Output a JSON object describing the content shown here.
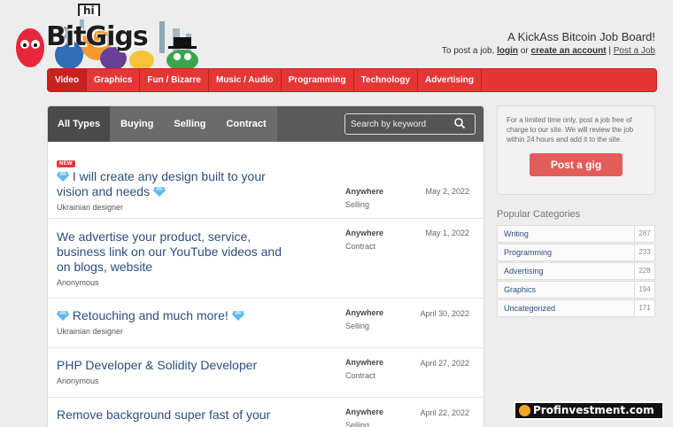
{
  "logo": {
    "hi": "hi",
    "word": "BitGigs"
  },
  "header": {
    "tagline": "A KickAss Bitcoin Job Board!",
    "post_prefix": "To post a job,",
    "login": "login",
    "or": "or",
    "create_account": "create an account",
    "sep": "|",
    "post_job": "Post a Job"
  },
  "nav": [
    "Video",
    "Graphics",
    "Fun / Bizarre",
    "Music / Audio",
    "Programming",
    "Technology",
    "Advertising"
  ],
  "filters": [
    "All Types",
    "Buying",
    "Selling",
    "Contract"
  ],
  "search": {
    "placeholder": "Search by keyword"
  },
  "jobs": [
    {
      "badge": "NEW",
      "title": "I will create any design built to your vision and needs",
      "who": "Ukrainian designer",
      "location": "Anywhere",
      "type": "Selling",
      "date": "May 2, 2022"
    },
    {
      "title": "We advertise your product, service, business link on our YouTube videos and on blogs, website",
      "who": "Anonymous",
      "location": "Anywhere",
      "type": "Contract",
      "date": "May 1, 2022"
    },
    {
      "title": "Retouching and much more!",
      "who": "Ukrainian designer",
      "location": "Anywhere",
      "type": "Selling",
      "date": "April 30, 2022"
    },
    {
      "title": "PHP Developer & Solidity Developer",
      "who": "Anonymous",
      "location": "Anywhere",
      "type": "Contract",
      "date": "April 27, 2022"
    },
    {
      "title": "Remove background super fast of your",
      "location": "Anywhere",
      "type": "Selling",
      "date": "April 22, 2022"
    }
  ],
  "sidebar": {
    "promo": "For a limited time only, post a job free of charge to our site. We will review the job within 24 hours and add it to the site.",
    "post_button": "Post a gig",
    "categories_heading": "Popular Categories",
    "categories": [
      {
        "name": "Writing",
        "count": "287"
      },
      {
        "name": "Programming",
        "count": "233"
      },
      {
        "name": "Advertising",
        "count": "228"
      },
      {
        "name": "Graphics",
        "count": "194"
      },
      {
        "name": "Uncategorized",
        "count": "171"
      }
    ]
  },
  "watermark": "Profinvestment.com",
  "colors": {
    "nav": "#e63535",
    "link": "#2c4d80",
    "button": "#e25d59"
  }
}
